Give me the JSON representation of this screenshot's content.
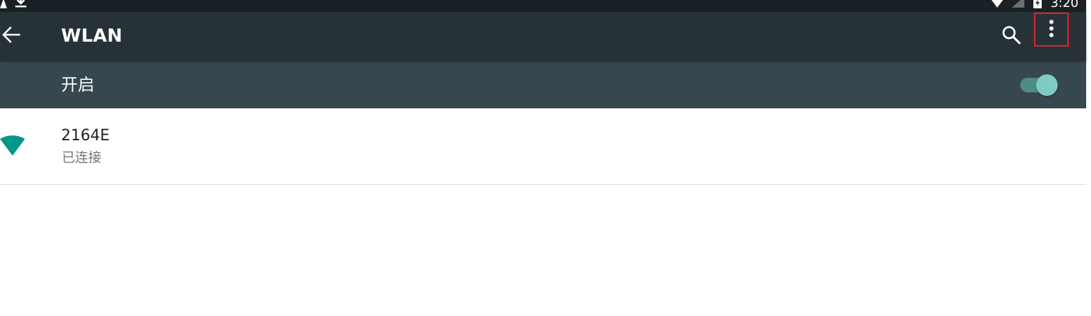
{
  "status_bar": {
    "time": "3:20",
    "icons": [
      "notification-a-icon",
      "download-icon",
      "wifi-signal-icon",
      "cell-signal-icon",
      "battery-icon"
    ]
  },
  "toolbar": {
    "title": "WLAN",
    "back_icon": "arrow-back-icon",
    "search_icon": "search-icon",
    "more_icon": "more-vert-icon",
    "background": "#263238"
  },
  "switch_bar": {
    "label": "开启",
    "enabled": true,
    "background": "#37474f",
    "accent": "#80cbc4"
  },
  "networks": [
    {
      "ssid": "2164E",
      "status": "已连接",
      "icon": "wifi-icon",
      "icon_color": "#009688"
    }
  ]
}
